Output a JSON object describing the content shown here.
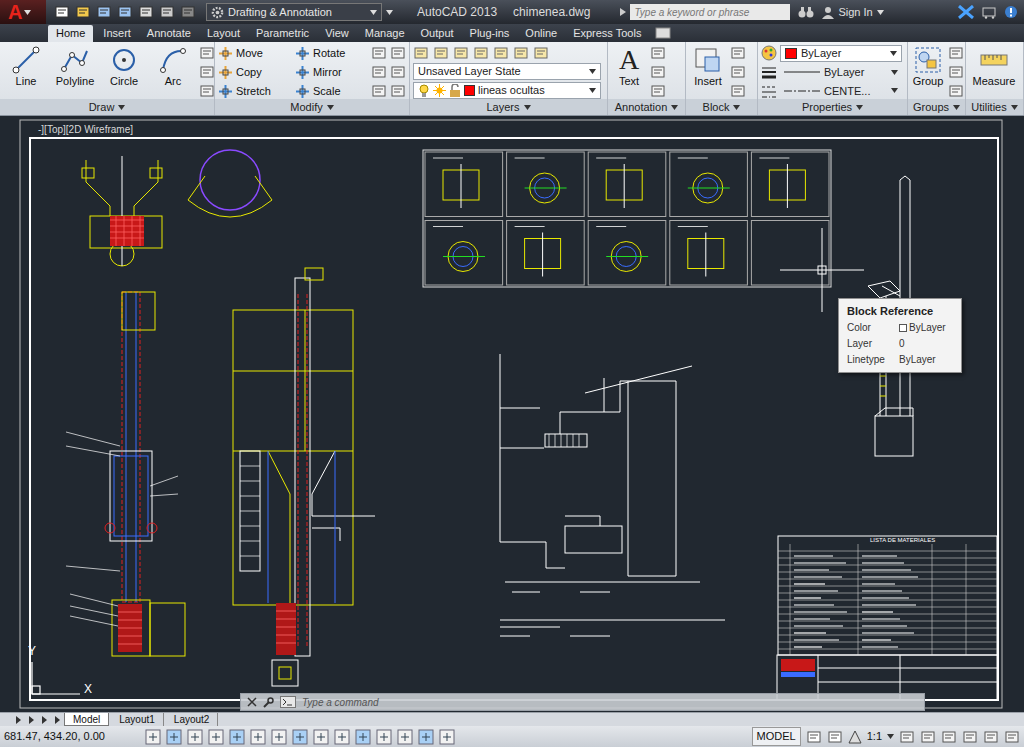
{
  "titlebar": {
    "logo": "A",
    "workspace": "Drafting & Annotation",
    "app_title": "AutoCAD 2013",
    "file_name": "chimenea.dwg",
    "search_placeholder": "Type a keyword or phrase",
    "sign_in": "Sign In"
  },
  "ribbon_tabs": [
    {
      "label": "Home",
      "selected": true
    },
    {
      "label": "Insert",
      "selected": false
    },
    {
      "label": "Annotate",
      "selected": false
    },
    {
      "label": "Layout",
      "selected": false
    },
    {
      "label": "Parametric",
      "selected": false
    },
    {
      "label": "View",
      "selected": false
    },
    {
      "label": "Manage",
      "selected": false
    },
    {
      "label": "Output",
      "selected": false
    },
    {
      "label": "Plug-ins",
      "selected": false
    },
    {
      "label": "Online",
      "selected": false
    },
    {
      "label": "Express Tools",
      "selected": false
    }
  ],
  "ribbon": {
    "draw": {
      "title": "Draw",
      "tools": [
        "Line",
        "Polyline",
        "Circle",
        "Arc"
      ]
    },
    "modify": {
      "title": "Modify",
      "tools": [
        "Move",
        "Rotate",
        "Copy",
        "Mirror",
        "Stretch",
        "Scale"
      ]
    },
    "layers": {
      "title": "Layers",
      "layer_state": "Unsaved Layer State",
      "current_layer": "lineas ocultas",
      "current_layer_color": "#ff0000"
    },
    "annotation": {
      "title": "Annotation",
      "tool": "Text",
      "tool_icon": "A"
    },
    "block": {
      "title": "Block",
      "tool": "Insert"
    },
    "properties": {
      "title": "Properties",
      "color": "ByLayer",
      "color_swatch": "#ff0000",
      "lineweight": "ByLayer",
      "linetype": "CENTE..."
    },
    "groups": {
      "title": "Groups",
      "tool": "Group"
    },
    "utilities": {
      "title": "Utilities",
      "tool": "Measure"
    }
  },
  "viewport": {
    "label": "-][Top][2D Wireframe]",
    "table_title": "LISTA DE MATERIALES",
    "ucs_x": "X",
    "ucs_y": "Y"
  },
  "tooltip": {
    "title": "Block Reference",
    "rows": [
      {
        "label": "Color",
        "value": "ByLayer"
      },
      {
        "label": "Layer",
        "value": "0"
      },
      {
        "label": "Linetype",
        "value": "ByLayer"
      }
    ]
  },
  "command_line": {
    "placeholder": "Type a command"
  },
  "layout_tabs": [
    {
      "label": "Model",
      "selected": true
    },
    {
      "label": "Layout1",
      "selected": false
    },
    {
      "label": "Layout2",
      "selected": false
    }
  ],
  "status_bar": {
    "coordinates": "681.47, 434.20, 0.00",
    "space": "MODEL",
    "scale": "1:1"
  }
}
